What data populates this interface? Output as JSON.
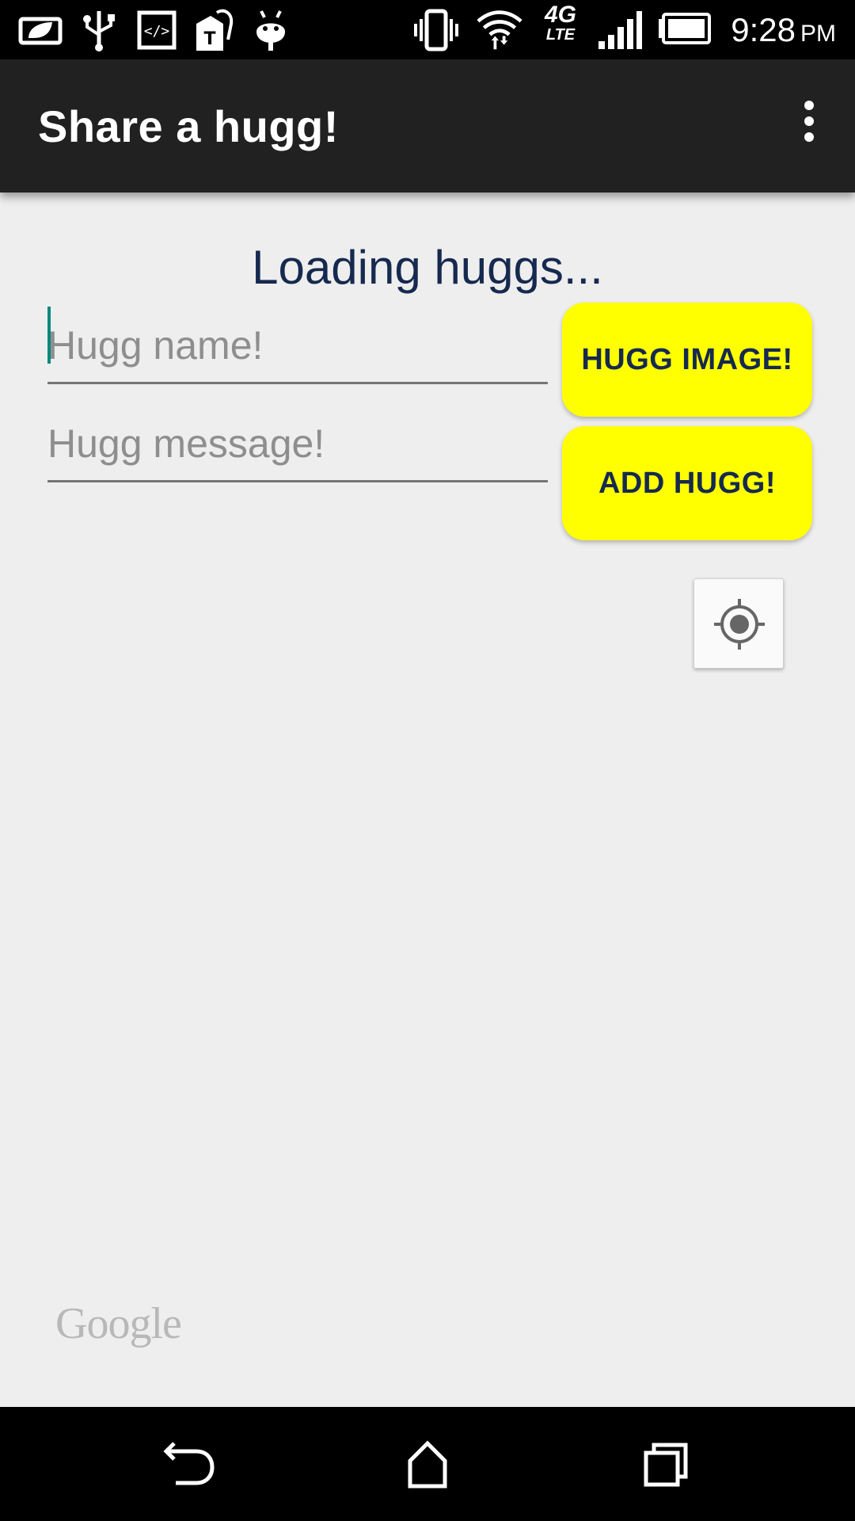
{
  "status_bar": {
    "time": "9:28",
    "ampm": "PM",
    "network": "4G",
    "network_sub": "LTE",
    "icons": [
      "battery-saver-icon",
      "usb-icon",
      "developer-code-icon",
      "tmobile-tag-icon",
      "android-debug-icon",
      "vibrate-icon",
      "wifi-icon",
      "lte-icon",
      "signal-icon",
      "battery-icon"
    ]
  },
  "app_bar": {
    "title": "Share a hugg!",
    "menu_icon": "overflow-menu-icon"
  },
  "main": {
    "loading_text": "Loading huggs...",
    "name_field": {
      "placeholder": "Hugg name!",
      "value": ""
    },
    "message_field": {
      "placeholder": "Hugg message!",
      "value": ""
    },
    "hugg_image_button": "HUGG IMAGE!",
    "add_hugg_button": "ADD HUGG!",
    "locate_icon": "my-location-icon",
    "map_attribution": "Google"
  },
  "nav_bar": {
    "icons": [
      "back-icon",
      "home-icon",
      "recents-icon"
    ]
  },
  "colors": {
    "accent": "#ffff00",
    "text_dark": "#16294f",
    "app_bar": "#212121",
    "background": "#eeeeee",
    "cursor": "#00897b"
  }
}
